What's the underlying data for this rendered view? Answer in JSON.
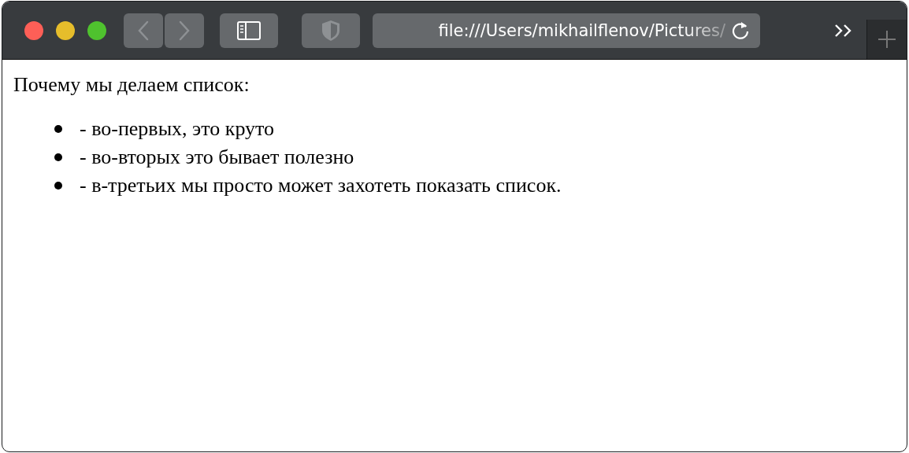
{
  "toolbar": {
    "address": "file:///Users/mikhailflenov/Pictures/"
  },
  "page": {
    "heading": "Почему мы делаем список:",
    "items": [
      "- во-первых, это круто",
      "- во-вторых это бывает полезно",
      "- в-третьих мы просто может захотеть показать список."
    ]
  }
}
